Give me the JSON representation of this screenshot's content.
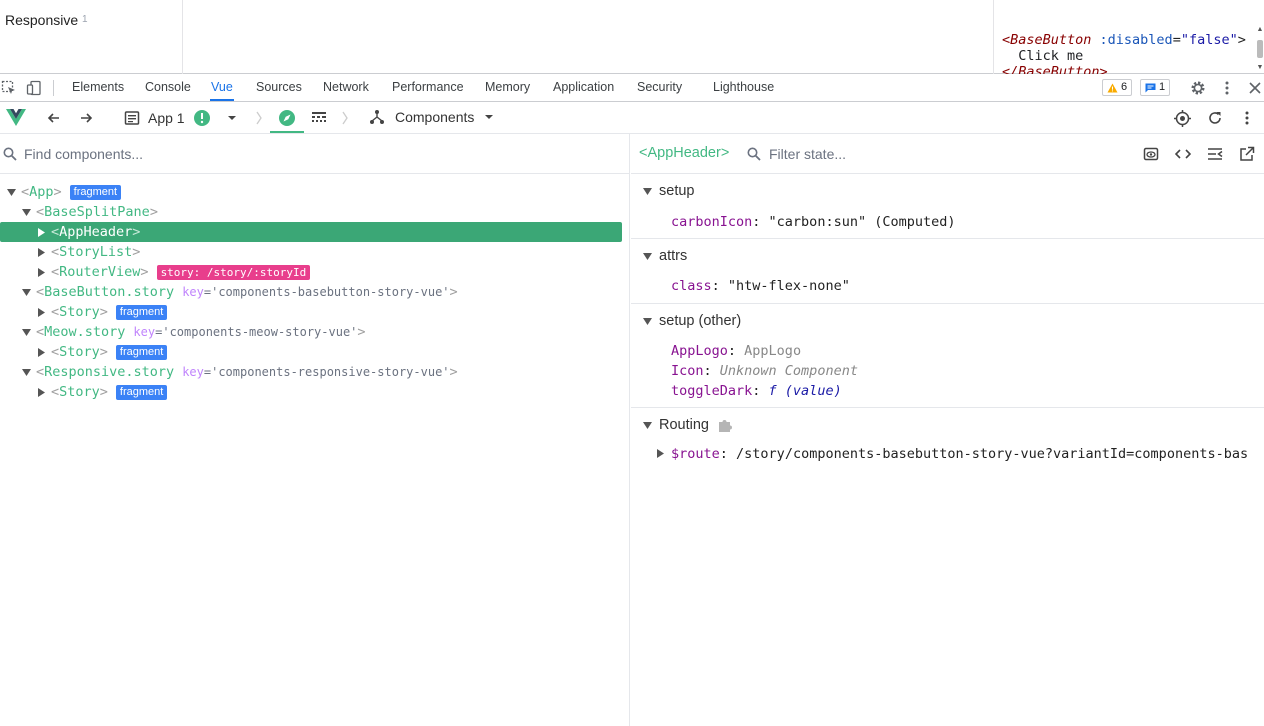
{
  "preview": {
    "story_title": "Responsive",
    "story_count": "1",
    "code": {
      "line1_tag": "<BaseButton",
      "line1_attr": " :disabled",
      "line1_eq": "=",
      "line1_val": "\"false\"",
      "line1_end": ">",
      "line2": "  Click me",
      "line3": "</BaseButton>"
    }
  },
  "devtools": {
    "tabs": [
      "Elements",
      "Console",
      "Vue",
      "Sources",
      "Network",
      "Performance",
      "Memory",
      "Application",
      "Security",
      "Lighthouse"
    ],
    "active_tab": "Vue",
    "warnings": "6",
    "messages": "1"
  },
  "vue_toolbar": {
    "app_label": "App 1",
    "view_label": "Components"
  },
  "left": {
    "search_placeholder": "Find components...",
    "tree": [
      {
        "name": "App",
        "tag": "fragment"
      },
      {
        "name": "BaseSplitPane"
      },
      {
        "name": "AppHeader",
        "selected": true
      },
      {
        "name": "StoryList"
      },
      {
        "name": "RouterView",
        "route": "story: /story/:storyId"
      },
      {
        "name": "BaseButton.story",
        "key_label": "key",
        "key_value": "'components-basebutton-story-vue'"
      },
      {
        "name": "Story",
        "tag": "fragment"
      },
      {
        "name": "Meow.story",
        "key_label": "key",
        "key_value": "'components-meow-story-vue'"
      },
      {
        "name": "Story",
        "tag": "fragment"
      },
      {
        "name": "Responsive.story",
        "key_label": "key",
        "key_value": "'components-responsive-story-vue'"
      },
      {
        "name": "Story",
        "tag": "fragment"
      }
    ]
  },
  "right": {
    "selected_component": "<AppHeader>",
    "filter_placeholder": "Filter state...",
    "sections": {
      "setup": {
        "title": "setup",
        "key": "carbonIcon",
        "value": "\"carbon:sun\" (Computed)"
      },
      "attrs": {
        "title": "attrs",
        "key": "class",
        "value": "\"htw-flex-none\""
      },
      "setup_other": {
        "title": "setup (other)",
        "rows": [
          {
            "key": "AppLogo",
            "value": "AppLogo"
          },
          {
            "key": "Icon",
            "value": "Unknown Component"
          },
          {
            "key": "toggleDark",
            "value": "f (value)"
          }
        ]
      },
      "routing": {
        "title": "Routing",
        "key": "$route",
        "value": "/story/components-basebutton-story-vue?variantId=components-bas"
      }
    }
  },
  "colors": {
    "vue_green": "#42b883",
    "selected_row": "#3ba776",
    "fragment_badge": "#3b82f6",
    "route_badge": "#e83e8c",
    "active_tab": "#1a73e8"
  }
}
